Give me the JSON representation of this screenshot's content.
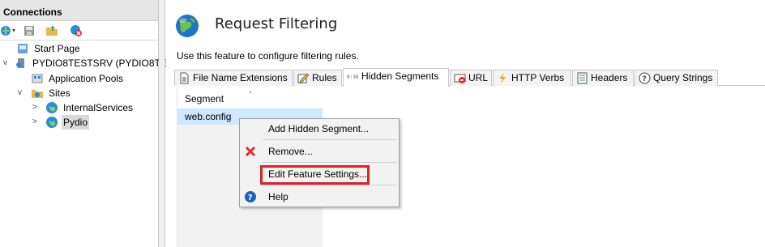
{
  "connections": {
    "header": "Connections",
    "tree": [
      {
        "label": "Start Page"
      },
      {
        "label": "PYDIO8TESTSRV (PYDIO8TEST"
      },
      {
        "label": "Application Pools"
      },
      {
        "label": "Sites"
      },
      {
        "label": "InternalServices"
      },
      {
        "label": "Pydio"
      }
    ]
  },
  "main": {
    "title": "Request Filtering",
    "description": "Use this feature to configure filtering rules.",
    "tabs": [
      {
        "label": "File Name Extensions"
      },
      {
        "label": "Rules"
      },
      {
        "label": "Hidden Segments"
      },
      {
        "label": "URL"
      },
      {
        "label": "HTTP Verbs"
      },
      {
        "label": "Headers"
      },
      {
        "label": "Query Strings"
      }
    ],
    "list": {
      "column": "Segment",
      "rows": [
        "web.config"
      ]
    }
  },
  "context_menu": {
    "items": [
      {
        "label": "Add Hidden Segment..."
      },
      {
        "label": "Remove..."
      },
      {
        "label": "Edit Feature Settings..."
      },
      {
        "label": "Help"
      }
    ]
  },
  "colors": {
    "highlight": "#e01f26",
    "selection": "#cde8ff"
  }
}
